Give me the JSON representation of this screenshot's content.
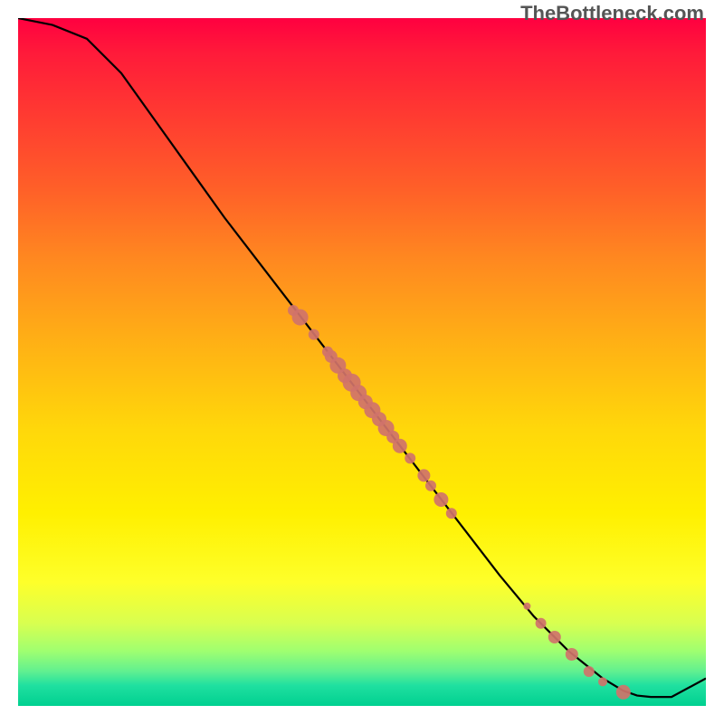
{
  "watermark": "TheBottleneck.com",
  "chart_data": {
    "type": "line",
    "title": "",
    "xlabel": "",
    "ylabel": "",
    "xlim": [
      0,
      100
    ],
    "ylim": [
      0,
      100
    ],
    "series": [
      {
        "name": "curve",
        "x": [
          0,
          5,
          10,
          15,
          20,
          25,
          30,
          35,
          40,
          45,
          50,
          55,
          60,
          65,
          70,
          75,
          80,
          85,
          88,
          90,
          92,
          95,
          100
        ],
        "y": [
          100,
          99,
          97,
          92,
          85,
          78,
          71,
          64.5,
          58,
          51.5,
          45,
          38.5,
          32,
          25.5,
          19,
          13,
          8,
          4,
          2.2,
          1.5,
          1.3,
          1.3,
          4
        ]
      }
    ],
    "scatter_points": [
      {
        "x": 40.0,
        "y": 57.5,
        "size": 6
      },
      {
        "x": 41.0,
        "y": 56.5,
        "size": 9
      },
      {
        "x": 43.0,
        "y": 54.0,
        "size": 6
      },
      {
        "x": 45.0,
        "y": 51.5,
        "size": 6
      },
      {
        "x": 45.5,
        "y": 50.8,
        "size": 7
      },
      {
        "x": 46.5,
        "y": 49.5,
        "size": 9
      },
      {
        "x": 47.5,
        "y": 48.0,
        "size": 8
      },
      {
        "x": 48.5,
        "y": 47.0,
        "size": 10
      },
      {
        "x": 49.5,
        "y": 45.5,
        "size": 9
      },
      {
        "x": 50.5,
        "y": 44.2,
        "size": 8
      },
      {
        "x": 51.5,
        "y": 43.0,
        "size": 9
      },
      {
        "x": 52.5,
        "y": 41.7,
        "size": 8
      },
      {
        "x": 53.5,
        "y": 40.4,
        "size": 9
      },
      {
        "x": 54.5,
        "y": 39.1,
        "size": 7
      },
      {
        "x": 55.5,
        "y": 37.8,
        "size": 8
      },
      {
        "x": 57.0,
        "y": 36.0,
        "size": 6
      },
      {
        "x": 59.0,
        "y": 33.5,
        "size": 7
      },
      {
        "x": 60.0,
        "y": 32.0,
        "size": 6
      },
      {
        "x": 61.5,
        "y": 30.0,
        "size": 8
      },
      {
        "x": 63.0,
        "y": 28.0,
        "size": 6
      },
      {
        "x": 74.0,
        "y": 14.5,
        "size": 4
      },
      {
        "x": 76.0,
        "y": 12.0,
        "size": 6
      },
      {
        "x": 78.0,
        "y": 10.0,
        "size": 7
      },
      {
        "x": 80.5,
        "y": 7.5,
        "size": 7
      },
      {
        "x": 83.0,
        "y": 5.0,
        "size": 6
      },
      {
        "x": 85.0,
        "y": 3.5,
        "size": 5
      },
      {
        "x": 88.0,
        "y": 2.0,
        "size": 8
      }
    ],
    "colors": {
      "line": "#000000",
      "points": "#d0736a"
    }
  }
}
